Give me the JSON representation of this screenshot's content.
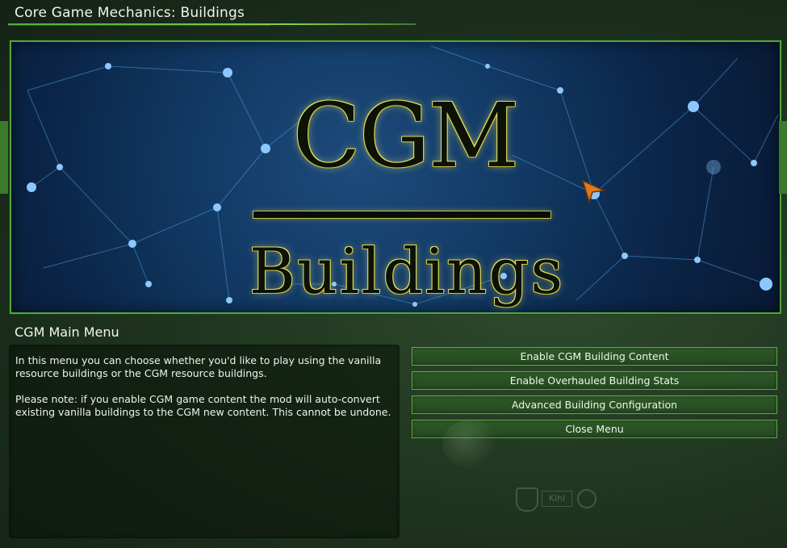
{
  "window": {
    "title": "Core Game Mechanics: Buildings"
  },
  "banner": {
    "logo_top": "CGM",
    "logo_bottom": "Buildings"
  },
  "menu": {
    "title": "CGM Main Menu",
    "description": [
      "In this menu you can choose whether you'd like to play using the vanilla resource buildings or the CGM resource buildings.",
      "Please note: if you enable CGM game content the mod will auto-convert existing vanilla buildings to the CGM new content. This cannot be undone."
    ],
    "buttons": [
      "Enable CGM Building Content",
      "Enable Overhauled Building Stats",
      "Advanced Building Configuration",
      "Close Menu"
    ]
  },
  "background": {
    "widget_label": "Kihl"
  },
  "colors": {
    "accent": "#4fa83a",
    "button_bg": "#2b5225",
    "logo_outline": "#e8e05a",
    "banner_blue": "#123a66"
  },
  "icons": {
    "cursor": "arrow-cursor-icon",
    "widget_left": "shield-icon",
    "widget_right": "knot-icon"
  }
}
